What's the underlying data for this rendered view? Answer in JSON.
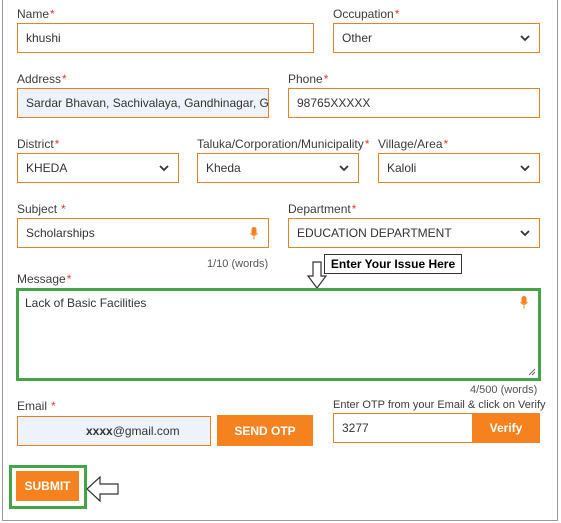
{
  "form": {
    "name": {
      "label": "Name",
      "required_mark": "*",
      "value": "khushi"
    },
    "occupation": {
      "label": "Occupation",
      "required_mark": "*",
      "value": "Other"
    },
    "address": {
      "label": "Address",
      "required_mark": "*",
      "value": "Sardar Bhavan, Sachivalaya, Gandhinagar, Guj"
    },
    "phone": {
      "label": "Phone",
      "required_mark": "*",
      "value": "98765XXXXX"
    },
    "district": {
      "label": "District",
      "required_mark": "*",
      "value": "KHEDA"
    },
    "taluka": {
      "label": "Taluka/Corporation/Municipality",
      "required_mark": "*",
      "value": "Kheda"
    },
    "village": {
      "label": "Village/Area",
      "required_mark": "*",
      "value": "Kaloli"
    },
    "subject": {
      "label": "Subject",
      "required_mark": "*",
      "value": "Scholarships",
      "counter": "1/10 (words)"
    },
    "department": {
      "label": "Department",
      "required_mark": "*",
      "value": "EDUCATION DEPARTMENT"
    },
    "message": {
      "label": "Message",
      "required_mark": "*",
      "value": "Lack of Basic Facilities",
      "counter": "4/500 (words)"
    },
    "email": {
      "label": "Email",
      "required_mark": "*",
      "value_masked": "xxxx",
      "value_domain": "@gmail.com",
      "send_otp_label": "SEND OTP"
    },
    "otp": {
      "label": "Enter OTP from your Email & click on Verify",
      "value": "3277",
      "verify_label": "Verify"
    },
    "submit_label": "SUBMIT"
  },
  "annotations": {
    "callout_text": "Enter Your Issue Here",
    "highlight_color": "#43a548"
  },
  "colors": {
    "accent": "#f5821f",
    "border": "#e8821e",
    "required": "#e53935",
    "filled_bg": "#eef2fb"
  },
  "icons": {
    "select_arrow": "chevron-down-icon",
    "mic": "microphone-icon",
    "pointer_down": "arrow-down-outline-icon",
    "pointer_left": "arrow-left-outline-icon"
  }
}
